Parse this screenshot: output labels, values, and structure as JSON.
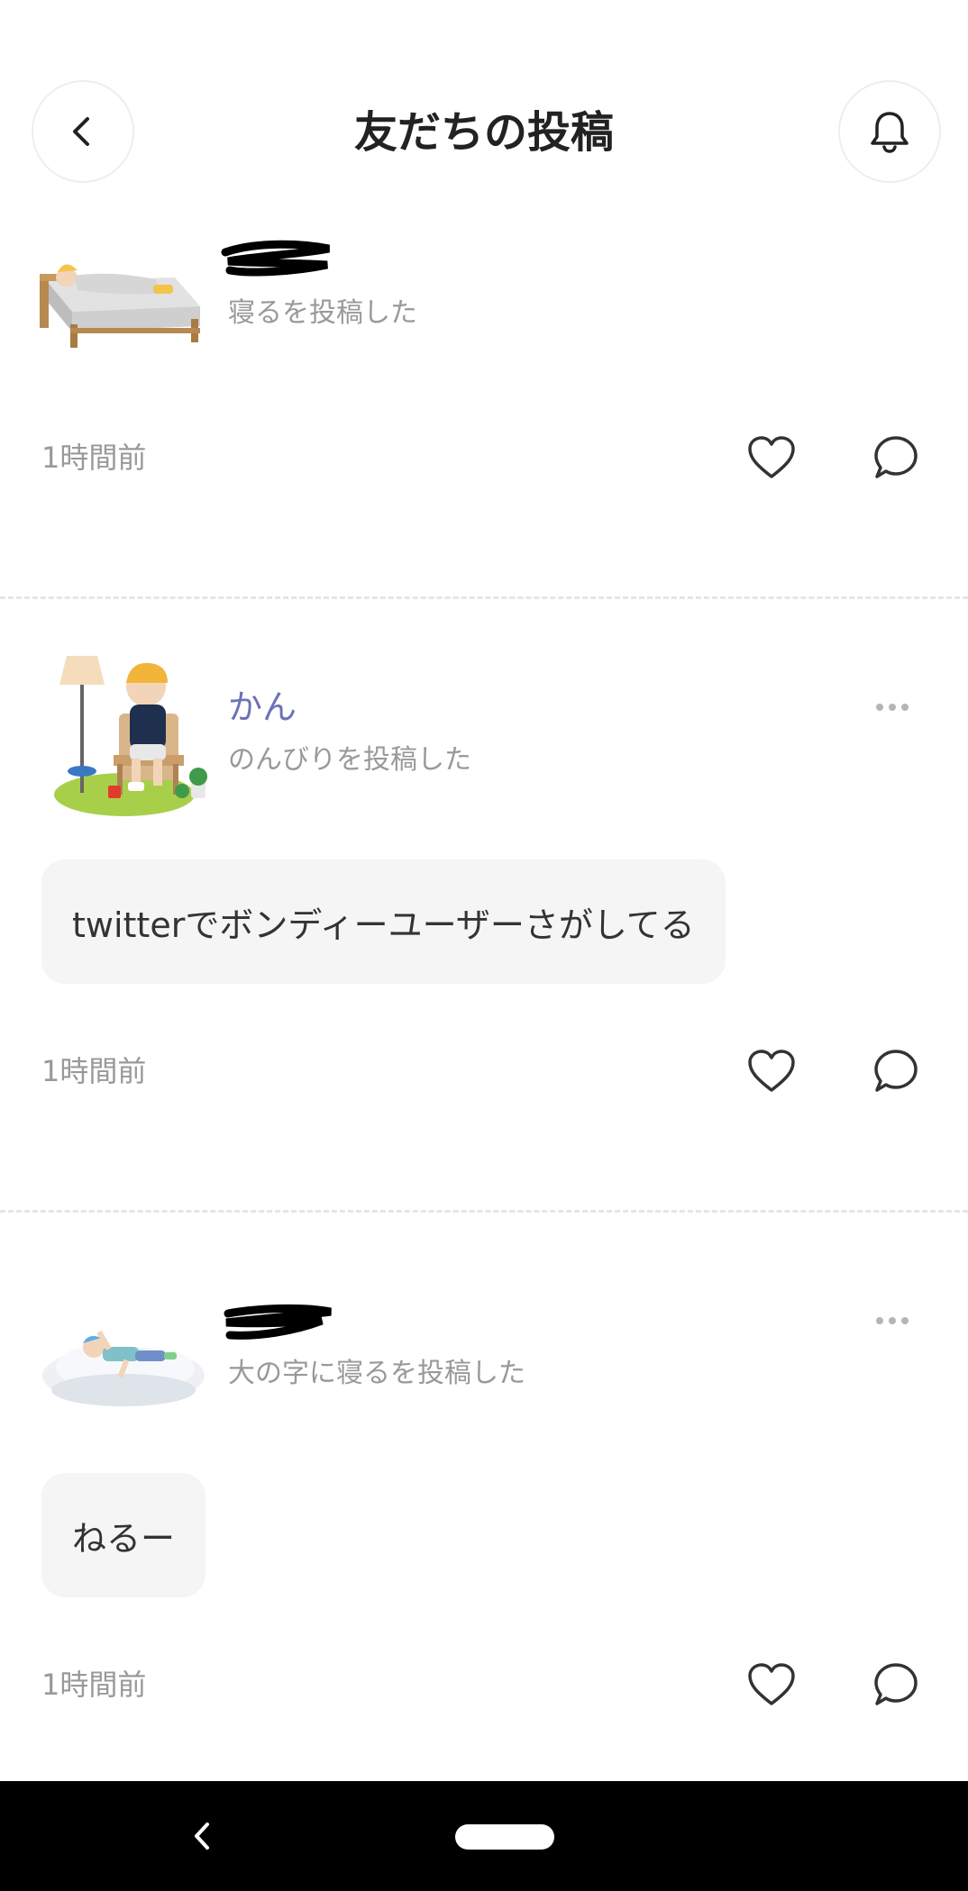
{
  "header": {
    "title": "友だちの投稿",
    "back_icon": "chevron-left-icon",
    "bell_icon": "bell-icon"
  },
  "posts": [
    {
      "name": "",
      "action": "寝るを投稿した",
      "message": "",
      "time": "1時間前",
      "avatar_icon": "sleeping-in-bed-avatar"
    },
    {
      "name": "かん",
      "action": "のんびりを投稿した",
      "message": "twitterでボンディーユーザーさがしてる",
      "time": "1時間前",
      "avatar_icon": "sitting-in-chair-avatar"
    },
    {
      "name": "",
      "action": "大の字に寝るを投稿した",
      "message": "ねるー",
      "time": "1時間前",
      "avatar_icon": "lying-on-cloud-avatar"
    }
  ],
  "colors": {
    "name": "#6b72b6",
    "subtext": "#999999",
    "bubble": "#f5f5f5",
    "navbar": "#000000"
  }
}
